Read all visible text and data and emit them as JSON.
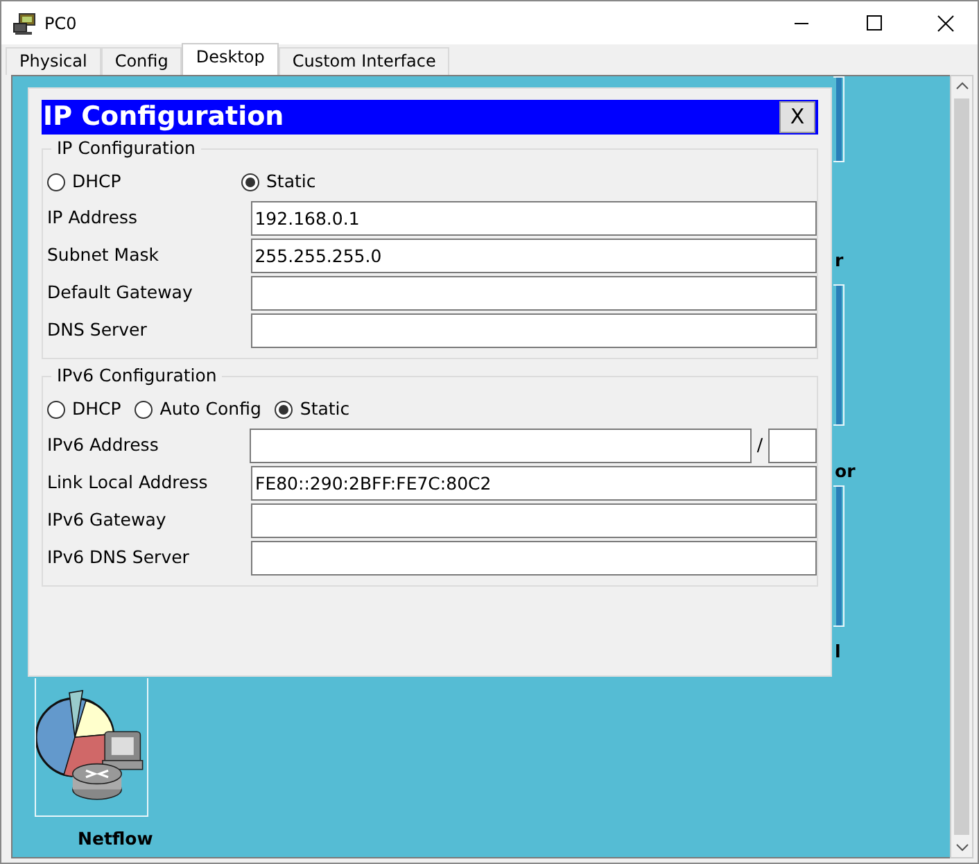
{
  "window": {
    "title": "PC0"
  },
  "tabs": [
    {
      "label": "Physical",
      "selected": false
    },
    {
      "label": "Config",
      "selected": false
    },
    {
      "label": "Desktop",
      "selected": true
    },
    {
      "label": "Custom Interface",
      "selected": false
    }
  ],
  "desktop_apps": [
    {
      "label": "r"
    },
    {
      "label": "or"
    },
    {
      "label": "l"
    },
    {
      "label": "Netflow"
    }
  ],
  "dialog": {
    "title": "IP Configuration",
    "close": "X",
    "sections": [
      {
        "legend": "IP Configuration",
        "modes": [
          {
            "label": "DHCP",
            "selected": false
          },
          {
            "label": "Static",
            "selected": true
          }
        ],
        "fields": [
          {
            "label": "IP Address",
            "kind": "text",
            "value": "192.168.0.1"
          },
          {
            "label": "Subnet Mask",
            "kind": "text",
            "value": "255.255.255.0"
          },
          {
            "label": "Default Gateway",
            "kind": "text"
          },
          {
            "label": "DNS Server",
            "kind": "text"
          }
        ]
      },
      {
        "legend": "IPv6 Configuration",
        "modes": [
          {
            "label": "DHCP",
            "selected": false
          },
          {
            "label": "Auto Config",
            "selected": false
          },
          {
            "label": "Static",
            "selected": true
          }
        ],
        "fields": [
          {
            "label": "IPv6 Address",
            "kind": "prefix",
            "separator": "/"
          },
          {
            "label": "Link Local Address",
            "kind": "text",
            "value": "FE80::290:2BFF:FE7C:80C2"
          },
          {
            "label": "IPv6 Gateway",
            "kind": "text"
          },
          {
            "label": "IPv6 DNS Server",
            "kind": "text"
          }
        ]
      }
    ]
  }
}
